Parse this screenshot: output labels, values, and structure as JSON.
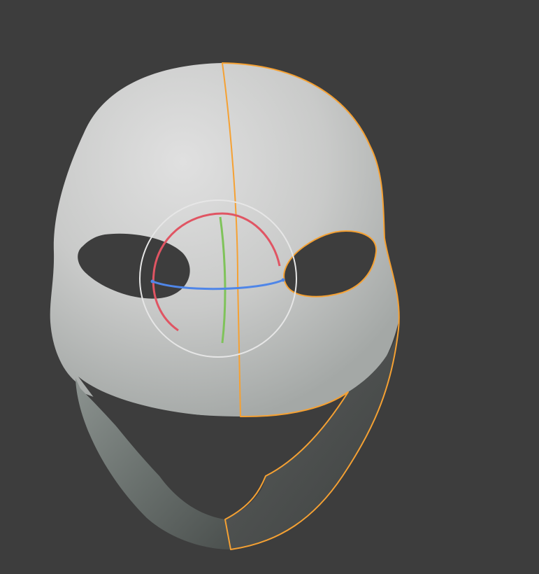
{
  "viewport": {
    "mode": "3d-viewport",
    "object": "mask-mesh",
    "selection": "right-half-selected"
  },
  "colors": {
    "background": "#3d3d3d",
    "mesh_light": "#d9d9d9",
    "mesh_mid": "#b5b8b6",
    "mesh_dark": "#6c726f",
    "selection": "#f5a133",
    "gizmo_circle": "#e6e6e6",
    "gizmo_x": "#e05563",
    "gizmo_y": "#7fc35a",
    "gizmo_z": "#4f86e8"
  },
  "icons": {
    "rotate_gizmo": "rotate-gizmo-icon"
  }
}
